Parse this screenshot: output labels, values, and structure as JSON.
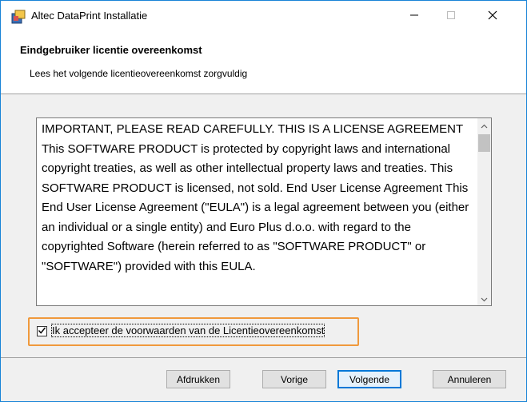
{
  "window": {
    "title": "Altec DataPrint Installatie"
  },
  "header": {
    "title": "Eindgebruiker licentie overeenkomst",
    "subtitle": "Lees het volgende licentieovereenkomst zorgvuldig"
  },
  "license": {
    "text": "IMPORTANT, PLEASE READ CAREFULLY. THIS IS A LICENSE AGREEMENT This SOFTWARE PRODUCT is protected by copyright laws and international copyright treaties, as well as other intellectual property laws and treaties. This SOFTWARE PRODUCT is licensed, not sold. End User License Agreement This End User License Agreement (\"EULA\") is a legal agreement between you (either an individual or a single entity) and Euro Plus d.o.o. with regard to the copyrighted Software (herein referred to as \"SOFTWARE PRODUCT\" or \"SOFTWARE\") provided with this EULA."
  },
  "accept": {
    "label": "Ik accepteer de voorwaarden van de Licentieovereenkomst",
    "checked": true
  },
  "buttons": {
    "print": "Afdrukken",
    "back": "Vorige",
    "next": "Volgende",
    "cancel": "Annuleren"
  },
  "colors": {
    "highlight": "#f0993c",
    "window_border": "#1883d7",
    "default_button_border": "#0078d7"
  }
}
